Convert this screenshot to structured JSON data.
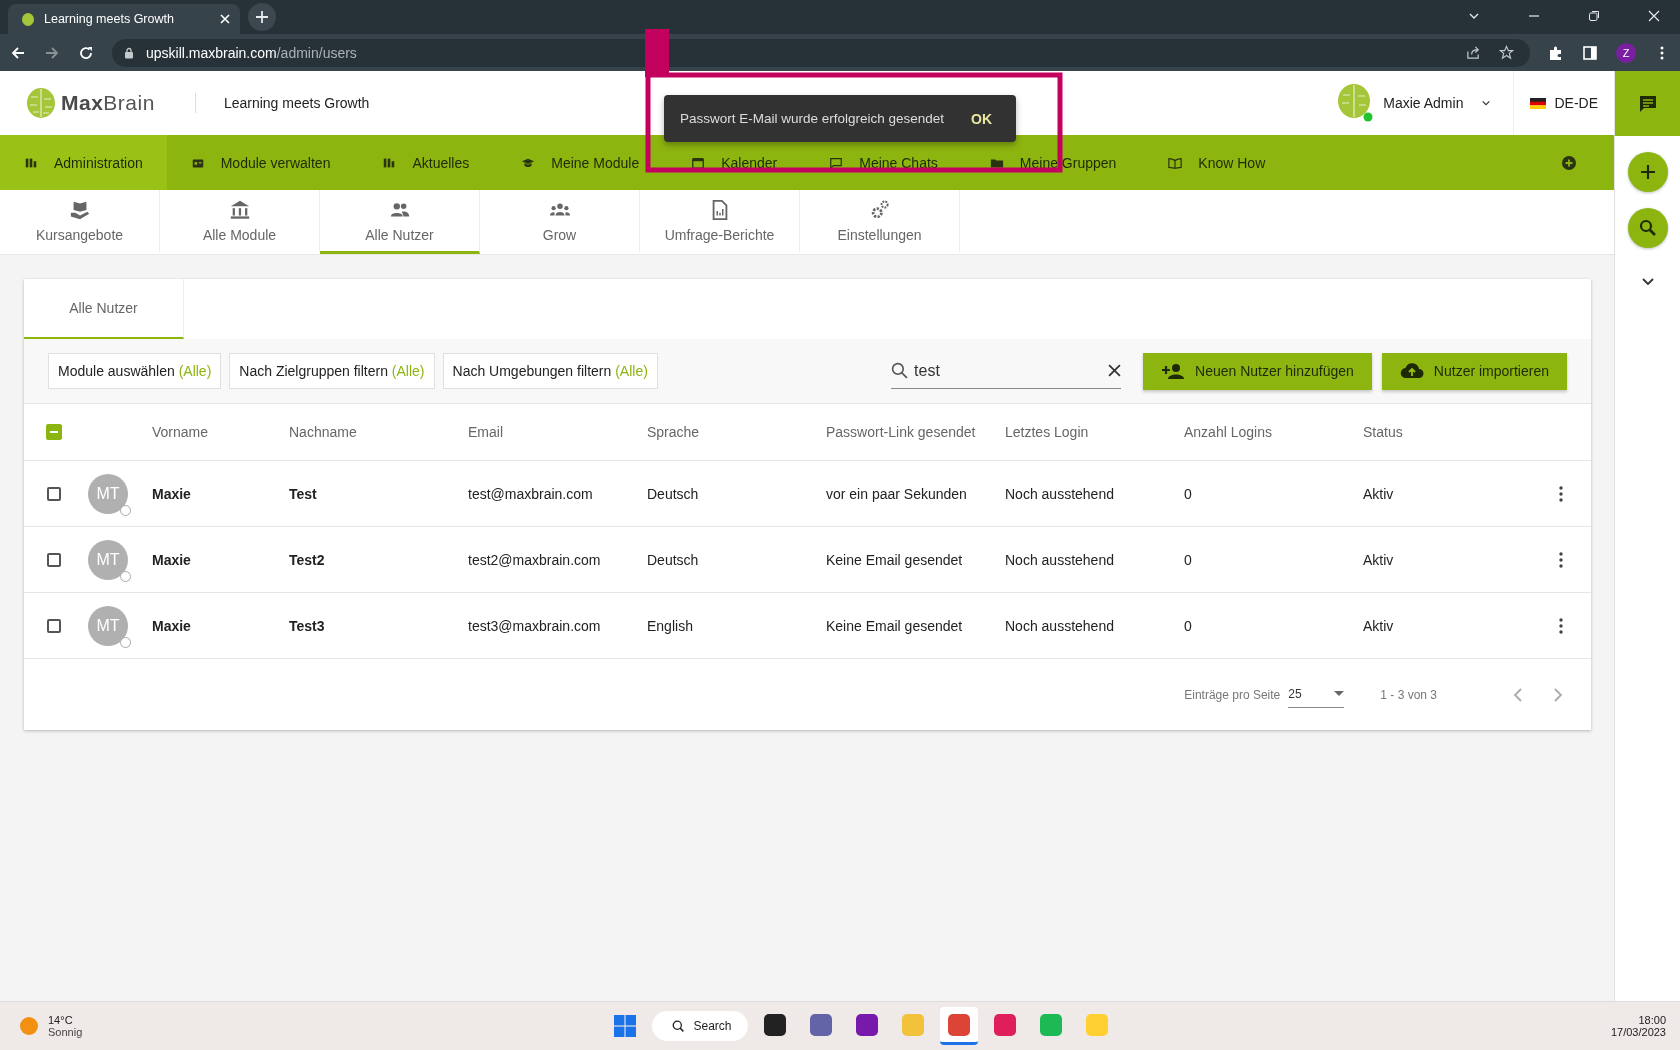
{
  "browser": {
    "tab_title": "Learning meets Growth",
    "url_host": "upskill.maxbrain.com",
    "url_path": "/admin/users",
    "profile_initial": "Z"
  },
  "header": {
    "brand_bold": "Max",
    "brand_light": "Brain",
    "tagline": "Learning meets Growth",
    "user_name": "Maxie Admin",
    "online": true,
    "language": "DE-DE"
  },
  "toast": {
    "message": "Passwort E-Mail wurde erfolgreich gesendet",
    "action": "OK"
  },
  "nav": [
    {
      "label": "Administration",
      "selected": true
    },
    {
      "label": "Module verwalten",
      "selected": false
    },
    {
      "label": "Aktuelles",
      "selected": false
    },
    {
      "label": "Meine Module",
      "selected": false
    },
    {
      "label": "Kalender",
      "selected": false
    },
    {
      "label": "Meine Chats",
      "selected": false
    },
    {
      "label": "Meine Gruppen",
      "selected": false
    },
    {
      "label": "Know How",
      "selected": false
    }
  ],
  "subtabs": [
    {
      "label": "Kursangebote",
      "selected": false
    },
    {
      "label": "Alle Module",
      "selected": false
    },
    {
      "label": "Alle Nutzer",
      "selected": true
    },
    {
      "label": "Grow",
      "selected": false
    },
    {
      "label": "Umfrage-Berichte",
      "selected": false
    },
    {
      "label": "Einstellungen",
      "selected": false
    }
  ],
  "panel": {
    "tab": "Alle Nutzer",
    "filters": [
      {
        "label": "Module auswählen",
        "hint": "(Alle)"
      },
      {
        "label": "Nach Zielgruppen filtern",
        "hint": "(Alle)"
      },
      {
        "label": "Nach Umgebungen filtern",
        "hint": "(Alle)"
      }
    ],
    "search": {
      "value": "test"
    },
    "buttons": [
      {
        "label": "Neuen Nutzer hinzufügen",
        "kind": "add-user"
      },
      {
        "label": "Nutzer importieren",
        "kind": "upload"
      }
    ]
  },
  "table": {
    "select_all": {
      "indeterminate": true
    },
    "columns": [
      "Vorname",
      "Nachname",
      "Email",
      "Sprache",
      "Passwort-Link gesendet",
      "Letztes Login",
      "Anzahl Logins",
      "Status"
    ],
    "rows": [
      {
        "selected": false,
        "initials": "MT",
        "online": false,
        "cells": [
          "Maxie",
          "Test",
          "test@maxbrain.com",
          "Deutsch",
          "vor ein paar Sekunden",
          "Noch ausstehend",
          "0",
          "Aktiv"
        ]
      },
      {
        "selected": false,
        "initials": "MT",
        "online": false,
        "cells": [
          "Maxie",
          "Test2",
          "test2@maxbrain.com",
          "Deutsch",
          "Keine Email gesendet",
          "Noch ausstehend",
          "0",
          "Aktiv"
        ]
      },
      {
        "selected": false,
        "initials": "MT",
        "online": false,
        "cells": [
          "Maxie",
          "Test3",
          "test3@maxbrain.com",
          "English",
          "Keine Email gesendet",
          "Noch ausstehend",
          "0",
          "Aktiv"
        ]
      }
    ]
  },
  "pagination": {
    "label": "Einträge pro Seite",
    "value": "25",
    "range": "1 - 3 von 3"
  },
  "taskbar": {
    "temperature": "14°C",
    "condition": "Sonnig",
    "search": "Search",
    "time": "18:00",
    "date": "17/03/2023",
    "apps": [
      {
        "selected": false
      },
      {
        "selected": false
      },
      {
        "selected": false
      },
      {
        "selected": false
      },
      {
        "selected": true
      },
      {
        "selected": false
      },
      {
        "selected": false
      },
      {
        "selected": false
      }
    ]
  }
}
